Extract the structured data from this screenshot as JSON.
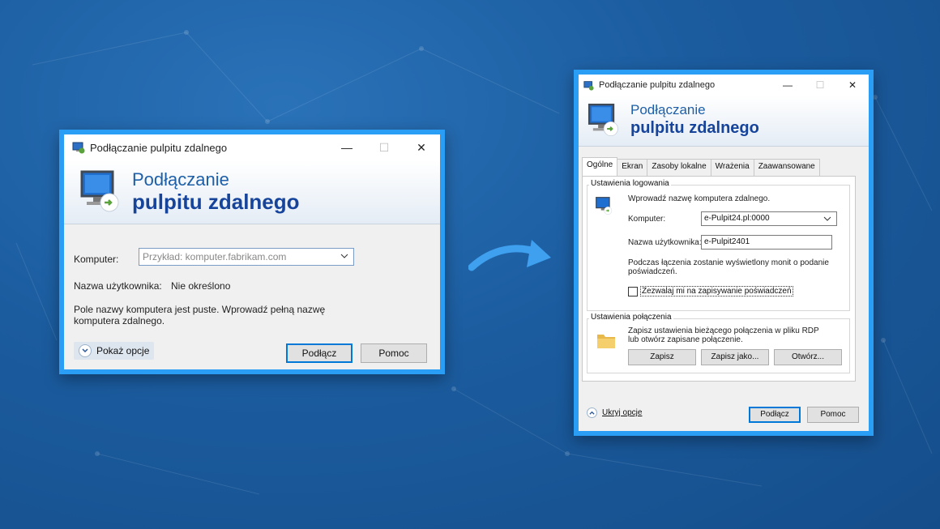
{
  "left_window": {
    "title": "Podłączanie pulpitu zdalnego",
    "banner_line1": "Podłączanie",
    "banner_line2": "pulpitu zdalnego",
    "computer_label": "Komputer:",
    "computer_placeholder": "Przykład: komputer.fabrikam.com",
    "username_label": "Nazwa użytkownika:",
    "username_value": "Nie określono",
    "message": "Pole nazwy komputera jest puste. Wprowadź pełną nazwę komputera zdalnego.",
    "show_options": "Pokaż opcje",
    "connect": "Podłącz",
    "help": "Pomoc"
  },
  "right_window": {
    "title": "Podłączanie pulpitu zdalnego",
    "banner_line1": "Podłączanie",
    "banner_line2": "pulpitu zdalnego",
    "tabs": [
      "Ogólne",
      "Ekran",
      "Zasoby lokalne",
      "Wrażenia",
      "Zaawansowane"
    ],
    "login_group": "Ustawienia logowania",
    "login_prompt": "Wprowadź nazwę komputera zdalnego.",
    "computer_label": "Komputer:",
    "computer_value": "e-Pulpit24.pl:0000",
    "username_label": "Nazwa użytkownika:",
    "username_value": "e-Pulpit2401",
    "credentials_note": "Podczas łączenia zostanie wyświetlony monit o podanie poświadczeń.",
    "save_credentials": "Zezwalaj mi na zapisywanie poświadczeń",
    "connection_group": "Ustawienia połączenia",
    "connection_note": "Zapisz ustawienia bieżącego połączenia w pliku RDP lub otwórz zapisane połączenie.",
    "save": "Zapisz",
    "save_as": "Zapisz jako...",
    "open": "Otwórz...",
    "hide_options": "Ukryj opcje",
    "connect": "Podłącz",
    "help": "Pomoc"
  },
  "icons": {
    "rdp": "remote-desktop-icon",
    "arrow": "curved-arrow-icon",
    "folder": "folder-icon"
  },
  "colors": {
    "frame": "#2a9df4",
    "banner_text": "#17449b",
    "background": "#1b5c9f"
  }
}
